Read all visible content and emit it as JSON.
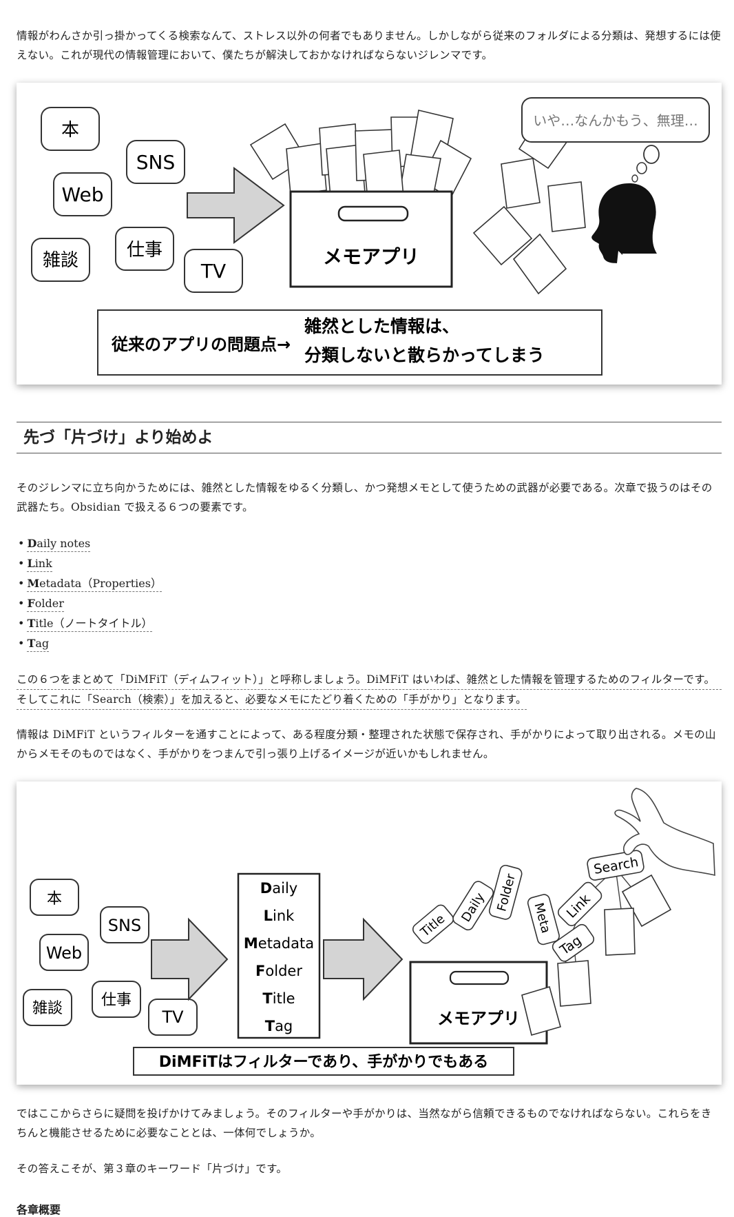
{
  "intro_paragraph": "情報がわんさか引っ掛かってくる検索なんて、ストレス以外の何者でもありません。しかしながら従来のフォルダによる分類は、発想するには使えない。これが現代の情報管理において、僕たちが解決しておかなければならないジレンマです。",
  "figure1": {
    "sources": [
      "本",
      "SNS",
      "Web",
      "仕事",
      "雑談",
      "TV"
    ],
    "box_label": "メモアプリ",
    "thought": "いや…なんかもう、無理…",
    "caption_left": "従来のアプリの問題点→",
    "caption_right_1": "雑然とした情報は、",
    "caption_right_2": "分類しないと散らかってしまう"
  },
  "section_title": "先づ「片づけ」より始めよ",
  "para_weapons": "そのジレンマに立ち向かうためには、雑然とした情報をゆるく分類し、かつ発想メモとして使うための武器が必要である。次章で扱うのはその武器たち。Obsidian で扱える６つの要素です。",
  "elements": [
    {
      "initial": "D",
      "rest": "aily notes"
    },
    {
      "initial": "L",
      "rest": "ink"
    },
    {
      "initial": "M",
      "rest": "etadata（Properties）"
    },
    {
      "initial": "F",
      "rest": "older"
    },
    {
      "initial": "T",
      "rest": "itle（ノートタイトル）"
    },
    {
      "initial": "T",
      "rest": "ag"
    }
  ],
  "para_dimfit_1": "この６つをまとめて「DiMFiT（ディムフィット）」と呼称しましょう。DiMFiT はいわば、雑然とした情報を管理するためのフィルターです。",
  "para_dimfit_2": "そしてこれに「Search（検索）」を加えると、必要なメモにたどり着くための「手がかり」となります。",
  "para_filter": "情報は DiMFiT というフィルターを通すことによって、ある程度分類・整理された状態で保存され、手がかりによって取り出される。メモの山からメモそのものではなく、手がかりをつまんで引っ張り上げるイメージが近いかもしれません。",
  "figure2": {
    "sources": [
      "本",
      "SNS",
      "Web",
      "仕事",
      "雑談",
      "TV"
    ],
    "filter_items": [
      {
        "initial": "D",
        "rest": "aily"
      },
      {
        "initial": "L",
        "rest": "ink"
      },
      {
        "initial": "M",
        "rest": "etadata"
      },
      {
        "initial": "F",
        "rest": "older"
      },
      {
        "initial": "T",
        "rest": "itle"
      },
      {
        "initial": "T",
        "rest": "ag"
      }
    ],
    "tabs": [
      "Title",
      "Daily",
      "Folder",
      "Meta"
    ],
    "hang_tags": [
      "Search",
      "Link",
      "Tag"
    ],
    "box_label": "メモアプリ",
    "caption": "DiMFiTはフィルターであり、手がかりでもある"
  },
  "para_question": "ではここからさらに疑問を投げかけてみましょう。そのフィルターや手がかりは、当然ながら信頼できるものでなければならない。これらをきちんと機能させるために必要なこととは、一体何でしょうか。",
  "para_answer": "その答えこそが、第３章のキーワード「片づけ」です。",
  "trailing_text": "各章概要"
}
